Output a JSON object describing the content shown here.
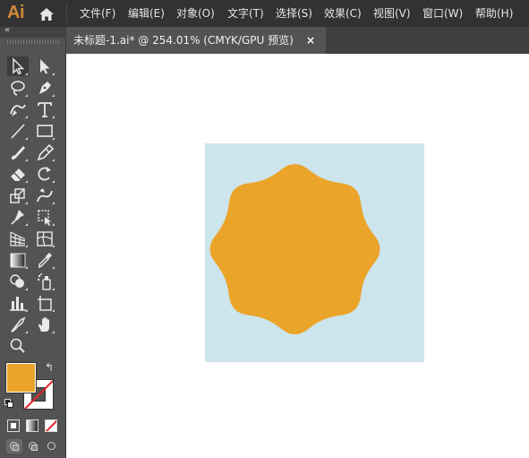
{
  "app": {
    "logo": "Ai",
    "menus": [
      {
        "label": "文件(F)"
      },
      {
        "label": "编辑(E)"
      },
      {
        "label": "对象(O)"
      },
      {
        "label": "文字(T)"
      },
      {
        "label": "选择(S)"
      },
      {
        "label": "效果(C)"
      },
      {
        "label": "视图(V)"
      },
      {
        "label": "窗口(W)"
      },
      {
        "label": "帮助(H)"
      }
    ]
  },
  "toolbar": {
    "collapse_glyph": "«",
    "swap_glyph": "↰",
    "tools": [
      {
        "name": "selection-tool",
        "icon": "arrow-icon"
      },
      {
        "name": "direct-selection-tool",
        "icon": "white-arrow-icon"
      },
      {
        "name": "lasso-tool",
        "icon": "lasso-icon"
      },
      {
        "name": "pen-tool",
        "icon": "pen-icon"
      },
      {
        "name": "curvature-tool",
        "icon": "curvature-icon"
      },
      {
        "name": "type-tool",
        "icon": "type-icon"
      },
      {
        "name": "line-tool",
        "icon": "line-icon"
      },
      {
        "name": "rectangle-tool",
        "icon": "rectangle-icon"
      },
      {
        "name": "paintbrush-tool",
        "icon": "brush-icon"
      },
      {
        "name": "pencil-tool",
        "icon": "pencil-icon"
      },
      {
        "name": "eraser-tool",
        "icon": "eraser-icon"
      },
      {
        "name": "rotate-tool",
        "icon": "rotate-icon"
      },
      {
        "name": "scale-tool",
        "icon": "scale-icon"
      },
      {
        "name": "warp-tool",
        "icon": "warp-icon"
      },
      {
        "name": "puppet-warp-tool",
        "icon": "pin-icon"
      },
      {
        "name": "free-transform-tool",
        "icon": "free-transform-icon"
      },
      {
        "name": "perspective-grid-tool",
        "icon": "perspective-icon"
      },
      {
        "name": "mesh-tool",
        "icon": "mesh-icon"
      },
      {
        "name": "gradient-tool",
        "icon": "gradient-icon"
      },
      {
        "name": "eyedropper-tool",
        "icon": "eyedropper-icon"
      },
      {
        "name": "shape-builder-tool",
        "icon": "shape-builder-icon"
      },
      {
        "name": "symbol-sprayer-tool",
        "icon": "symbol-sprayer-icon"
      },
      {
        "name": "column-graph-tool",
        "icon": "bar-graph-icon"
      },
      {
        "name": "artboard-tool",
        "icon": "artboard-icon"
      },
      {
        "name": "slice-tool",
        "icon": "slice-icon"
      },
      {
        "name": "hand-tool",
        "icon": "hand-icon"
      },
      {
        "name": "zoom-tool",
        "icon": "zoom-icon"
      }
    ],
    "fill_color": "#eba42a",
    "stroke_color": "none"
  },
  "document": {
    "tab_title": "未标题-1.ai* @ 254.01% (CMYK/GPU 预览)",
    "close_glyph": "×",
    "artboard_color": "#cde5ec",
    "shape": {
      "type": "eight-point-star",
      "points": 8,
      "fill": "#eba42a"
    }
  }
}
